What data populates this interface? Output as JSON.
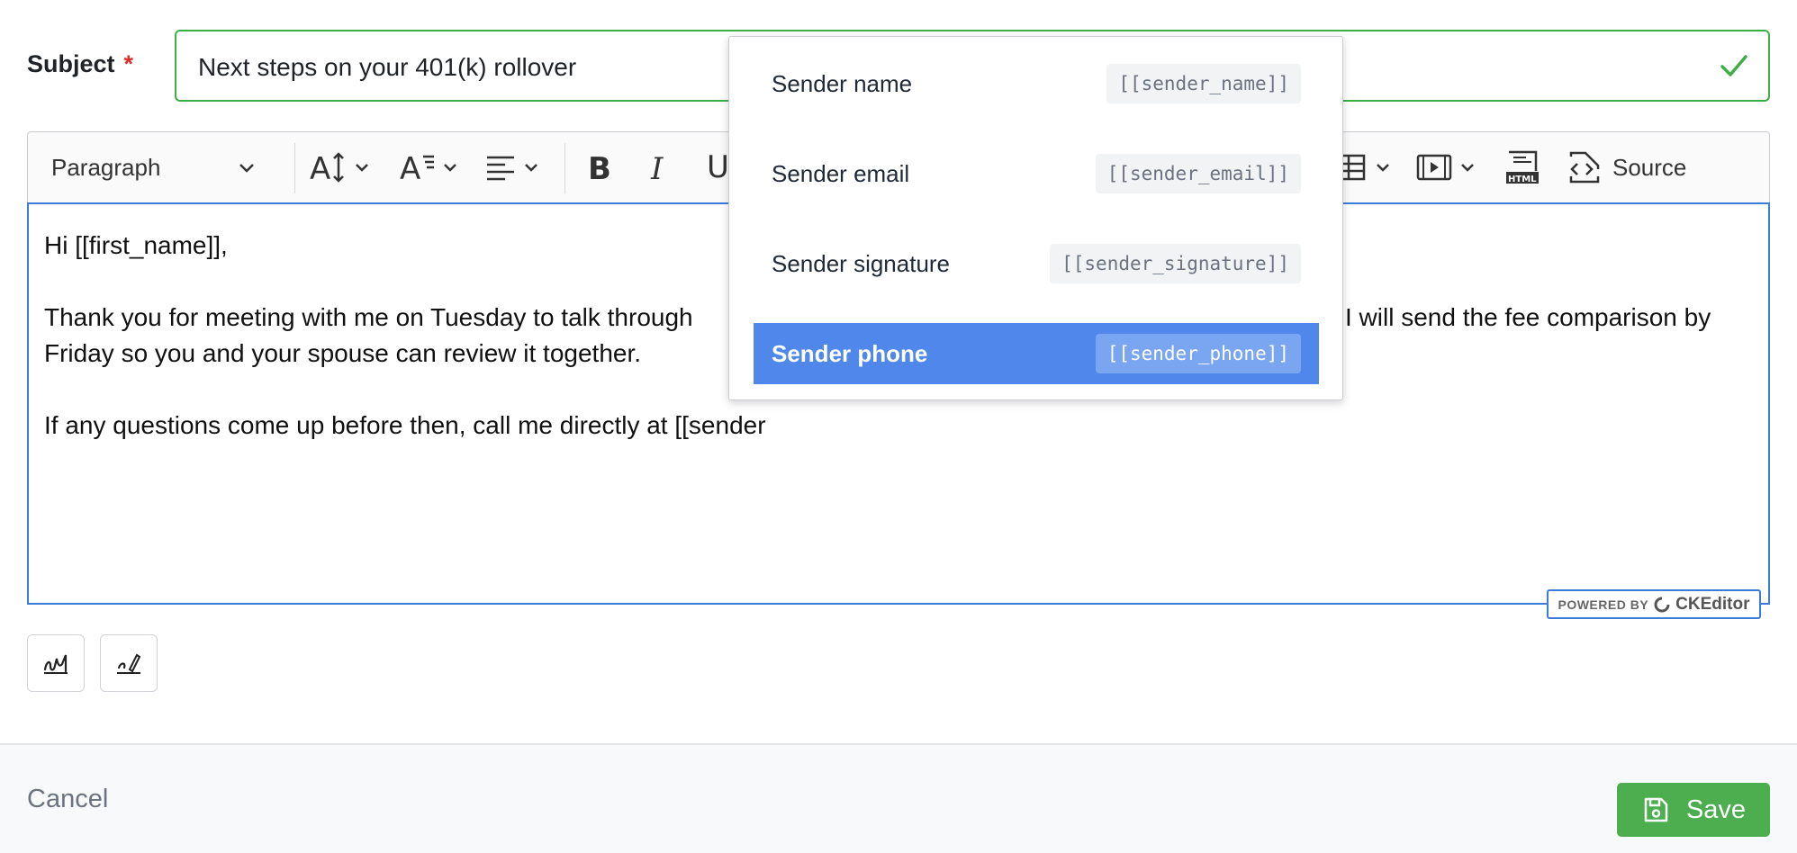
{
  "subject": {
    "label": "Subject",
    "required_marker": "*",
    "value": "Next steps on your 401(k) rollover"
  },
  "toolbar": {
    "paragraph_label": "Paragraph",
    "source_label": "Source",
    "icons": [
      "font-size-icon",
      "font-family-icon",
      "align-icon",
      "bold-icon",
      "italic-icon",
      "underline-icon",
      "table-icon",
      "media-icon",
      "html-embed-icon",
      "source-icon"
    ]
  },
  "editor": {
    "line1": "Hi [[first_name]],",
    "line2": "Thank you for meeting with me on Tuesday to talk through",
    "line2_end": "I will send the fee comparison by",
    "line3": "Friday so you and your spouse can review it together.",
    "line4": "If any questions come up before then, call me directly at [[sender"
  },
  "powered_by": {
    "prefix": "POWERED BY",
    "brand": "CKEditor"
  },
  "mention_dropdown": {
    "items": [
      {
        "label": "Sender name",
        "tag": "[[sender_name]]"
      },
      {
        "label": "Sender email",
        "tag": "[[sender_email]]"
      },
      {
        "label": "Sender signature",
        "tag": "[[sender_signature]]"
      },
      {
        "label": "Sender phone",
        "tag": "[[sender_phone]]",
        "active": true
      }
    ]
  },
  "footer": {
    "cancel_label": "Cancel",
    "save_label": "Save"
  },
  "colors": {
    "valid_border": "#3fae49",
    "focus_border": "#3d7bd9",
    "active_item": "#4f87eb",
    "save_button": "#4cae4f",
    "required": "#d93025"
  }
}
